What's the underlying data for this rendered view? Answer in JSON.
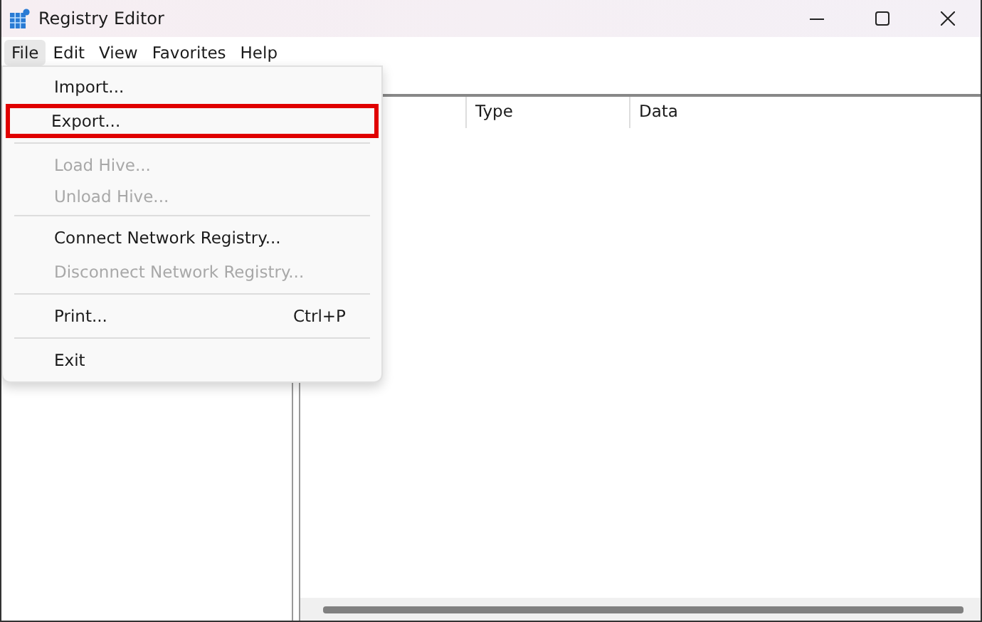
{
  "window": {
    "title": "Registry Editor"
  },
  "menubar": [
    {
      "label": "File",
      "selected": true
    },
    {
      "label": "Edit",
      "selected": false
    },
    {
      "label": "View",
      "selected": false
    },
    {
      "label": "Favorites",
      "selected": false
    },
    {
      "label": "Help",
      "selected": false
    }
  ],
  "file_menu": [
    {
      "kind": "item",
      "label": "Import...",
      "disabled": false,
      "highlighted": false
    },
    {
      "kind": "item",
      "label": "Export...",
      "disabled": false,
      "highlighted": true
    },
    {
      "kind": "separator"
    },
    {
      "kind": "item",
      "label": "Load Hive...",
      "disabled": true,
      "highlighted": false
    },
    {
      "kind": "item",
      "label": "Unload Hive...",
      "disabled": true,
      "highlighted": false
    },
    {
      "kind": "separator"
    },
    {
      "kind": "item",
      "label": "Connect Network Registry...",
      "disabled": false,
      "highlighted": false
    },
    {
      "kind": "item",
      "label": "Disconnect Network Registry...",
      "disabled": true,
      "highlighted": false
    },
    {
      "kind": "separator"
    },
    {
      "kind": "item",
      "label": "Print...",
      "shortcut": "Ctrl+P",
      "disabled": false,
      "highlighted": false
    },
    {
      "kind": "separator"
    },
    {
      "kind": "item",
      "label": "Exit",
      "disabled": false,
      "highlighted": false
    }
  ],
  "table": {
    "columns": [
      "Type",
      "Data"
    ]
  }
}
